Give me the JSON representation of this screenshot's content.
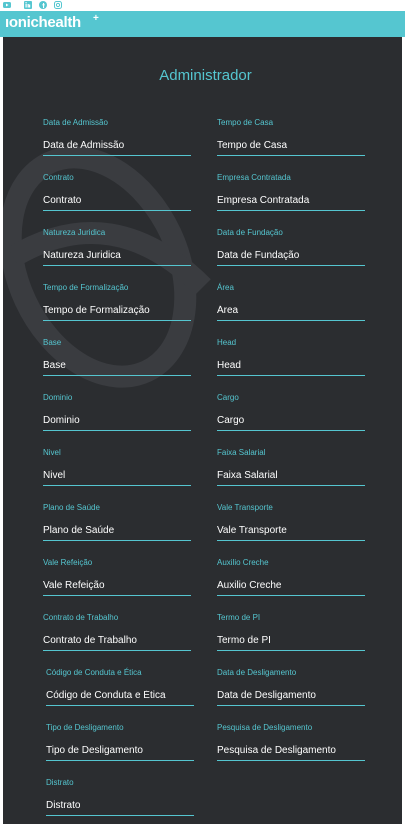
{
  "social": {
    "icons": [
      "youtube-icon",
      "linkedin-icon",
      "facebook-icon",
      "instagram-icon"
    ]
  },
  "header": {
    "brand": "ıonichealth",
    "brand_mark": "+"
  },
  "page": {
    "title": "Administrador"
  },
  "colors": {
    "accent": "#55c6d0",
    "panel_bg": "#2b2d30",
    "text": "#ffffff"
  },
  "form": {
    "fields": [
      {
        "label": "Data de Admissão",
        "placeholder": "Data de Admissão"
      },
      {
        "label": "Tempo de Casa",
        "placeholder": "Tempo de Casa"
      },
      {
        "label": "Contrato",
        "placeholder": "Contrato"
      },
      {
        "label": "Empresa Contratada",
        "placeholder": "Empresa Contratada"
      },
      {
        "label": "Natureza Juridica",
        "placeholder": "Natureza Juridica"
      },
      {
        "label": "Data de Fundação",
        "placeholder": "Data de Fundação"
      },
      {
        "label": "Tempo de Formalização",
        "placeholder": "Tempo de Formalização"
      },
      {
        "label": "Área",
        "placeholder": "Área"
      },
      {
        "label": "Base",
        "placeholder": "Base"
      },
      {
        "label": "Head",
        "placeholder": "Head"
      },
      {
        "label": "Dominio",
        "placeholder": "Dominio"
      },
      {
        "label": "Cargo",
        "placeholder": "Cargo"
      },
      {
        "label": "Nivel",
        "placeholder": "Nivel"
      },
      {
        "label": "Faixa Salarial",
        "placeholder": "Faixa Salarial"
      },
      {
        "label": "Plano de Saúde",
        "placeholder": "Plano de Saúde"
      },
      {
        "label": "Vale Transporte",
        "placeholder": "Vale Transporte"
      },
      {
        "label": "Vale Refeição",
        "placeholder": "Vale Refeição"
      },
      {
        "label": "Auxilio Creche",
        "placeholder": "Auxilio Creche"
      },
      {
        "label": "Contrato de Trabalho",
        "placeholder": "Contrato de Trabalho"
      },
      {
        "label": "Termo de PI",
        "placeholder": "Termo de PI"
      },
      {
        "label": "Código de Conduta e Ética",
        "placeholder": "Código de Conduta e Ética"
      },
      {
        "label": "Data de Desligamento",
        "placeholder": "Data de Desligamento"
      },
      {
        "label": "Tipo de Desligamento",
        "placeholder": "Tipo de Desligamento"
      },
      {
        "label": "Pesquisa de Desligamento",
        "placeholder": "Pesquisa de Desligamento"
      },
      {
        "label": "Distrato",
        "placeholder": "Distrato"
      }
    ]
  }
}
